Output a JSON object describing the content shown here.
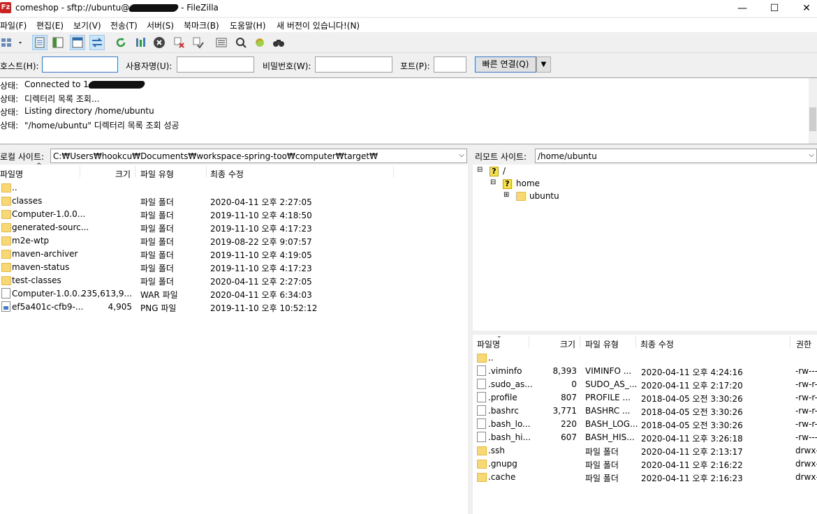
{
  "window": {
    "title_prefix": "comeshop - sftp://ubuntu@",
    "title_suffix": "- FileZilla",
    "minimize": "—",
    "maximize": "☐",
    "close": "✕"
  },
  "menu": [
    "파일(F)",
    "편집(E)",
    "보기(V)",
    "전송(T)",
    "서버(S)",
    "북마크(B)",
    "도움말(H)",
    "새 버전이 있습니다!(N)"
  ],
  "quickconnect": {
    "host_label": "호스트(H):",
    "user_label": "사용자명(U):",
    "pass_label": "비밀번호(W):",
    "port_label": "포트(P):",
    "button_label": "빠른 연결(Q)",
    "host_value": "",
    "user_value": "",
    "pass_value": "",
    "port_value": ""
  },
  "log": [
    {
      "label": "상태:",
      "message": "Connected to 1"
    },
    {
      "label": "상태:",
      "message": "디렉터리 목록 조회..."
    },
    {
      "label": "상태:",
      "message": "Listing directory /home/ubuntu"
    },
    {
      "label": "상태:",
      "message": "\"/home/ubuntu\" 디렉터리 목록 조회 성공"
    }
  ],
  "local": {
    "site_label": "로컬 사이트:",
    "path": "C:₩Users₩hookcu₩Documents₩workspace-spring-too₩computer₩target₩",
    "columns": {
      "name": "파일명",
      "size": "크기",
      "type": "파일 유형",
      "modified": "최종 수정"
    },
    "files": [
      {
        "icon": "folder",
        "name": "..",
        "size": "",
        "type": "",
        "modified": ""
      },
      {
        "icon": "folder",
        "name": "classes",
        "size": "",
        "type": "파일 폴더",
        "modified": "2020-04-11 오후 2:27:05"
      },
      {
        "icon": "folder",
        "name": "Computer-1.0.0...",
        "size": "",
        "type": "파일 폴더",
        "modified": "2019-11-10 오후 4:18:50"
      },
      {
        "icon": "folder",
        "name": "generated-sourc...",
        "size": "",
        "type": "파일 폴더",
        "modified": "2019-11-10 오후 4:17:23"
      },
      {
        "icon": "folder",
        "name": "m2e-wtp",
        "size": "",
        "type": "파일 폴더",
        "modified": "2019-08-22 오후 9:07:57"
      },
      {
        "icon": "folder",
        "name": "maven-archiver",
        "size": "",
        "type": "파일 폴더",
        "modified": "2019-11-10 오후 4:19:05"
      },
      {
        "icon": "folder",
        "name": "maven-status",
        "size": "",
        "type": "파일 폴더",
        "modified": "2019-11-10 오후 4:17:23"
      },
      {
        "icon": "folder",
        "name": "test-classes",
        "size": "",
        "type": "파일 폴더",
        "modified": "2020-04-11 오후 2:27:05"
      },
      {
        "icon": "file",
        "name": "Computer-1.0.0...",
        "size": "235,613,9...",
        "type": "WAR 파일",
        "modified": "2020-04-11 오후 6:34:03"
      },
      {
        "icon": "png",
        "name": "ef5a401c-cfb9-...",
        "size": "4,905",
        "type": "PNG 파일",
        "modified": "2019-11-10 오후 10:52:12"
      }
    ]
  },
  "remote": {
    "site_label": "리모트 사이트:",
    "path": "/home/ubuntu",
    "tree": [
      {
        "label": "/",
        "toggle": "⊟"
      },
      {
        "label": "home",
        "toggle": "⊟"
      },
      {
        "label": "ubuntu",
        "toggle": "⊞"
      }
    ],
    "columns": {
      "name": "파일명",
      "size": "크기",
      "type": "파일 유형",
      "modified": "최종 수정",
      "perm": "권한"
    },
    "files": [
      {
        "icon": "folder",
        "name": "..",
        "size": "",
        "type": "",
        "modified": "",
        "perm": ""
      },
      {
        "icon": "file",
        "name": ".viminfo",
        "size": "8,393",
        "type": "VIMINFO ...",
        "modified": "2020-04-11 오후 4:24:16",
        "perm": "-rw----"
      },
      {
        "icon": "file",
        "name": ".sudo_as...",
        "size": "0",
        "type": "SUDO_AS_...",
        "modified": "2020-04-11 오후 2:17:20",
        "perm": "-rw-r-"
      },
      {
        "icon": "file",
        "name": ".profile",
        "size": "807",
        "type": "PROFILE ...",
        "modified": "2018-04-05 오전 3:30:26",
        "perm": "-rw-r-"
      },
      {
        "icon": "file",
        "name": ".bashrc",
        "size": "3,771",
        "type": "BASHRC ...",
        "modified": "2018-04-05 오전 3:30:26",
        "perm": "-rw-r-"
      },
      {
        "icon": "file",
        "name": ".bash_lo...",
        "size": "220",
        "type": "BASH_LOG...",
        "modified": "2018-04-05 오전 3:30:26",
        "perm": "-rw-r-"
      },
      {
        "icon": "file",
        "name": ".bash_hi...",
        "size": "607",
        "type": "BASH_HIS...",
        "modified": "2020-04-11 오후 3:26:18",
        "perm": "-rw----"
      },
      {
        "icon": "folder",
        "name": ".ssh",
        "size": "",
        "type": "파일 폴더",
        "modified": "2020-04-11 오후 2:13:17",
        "perm": "drwx-"
      },
      {
        "icon": "folder",
        "name": ".gnupg",
        "size": "",
        "type": "파일 폴더",
        "modified": "2020-04-11 오후 2:16:22",
        "perm": "drwx-"
      },
      {
        "icon": "folder",
        "name": ".cache",
        "size": "",
        "type": "파일 폴더",
        "modified": "2020-04-11 오후 2:16:23",
        "perm": "drwx-"
      }
    ]
  },
  "toolbar_icons": [
    "site-manager-icon",
    "toggle-log-icon",
    "toggle-local-tree-icon",
    "toggle-remote-tree-icon",
    "toggle-queue-icon",
    "refresh-icon",
    "process-queue-icon",
    "cancel-icon",
    "disconnect-icon",
    "reconnect-icon",
    "filter-icon",
    "compare-icon",
    "sync-browse-icon",
    "search-icon"
  ],
  "colors": {
    "accent": "#3b78c8",
    "folder": "#f8d775",
    "pressed": "#cce4f7"
  }
}
